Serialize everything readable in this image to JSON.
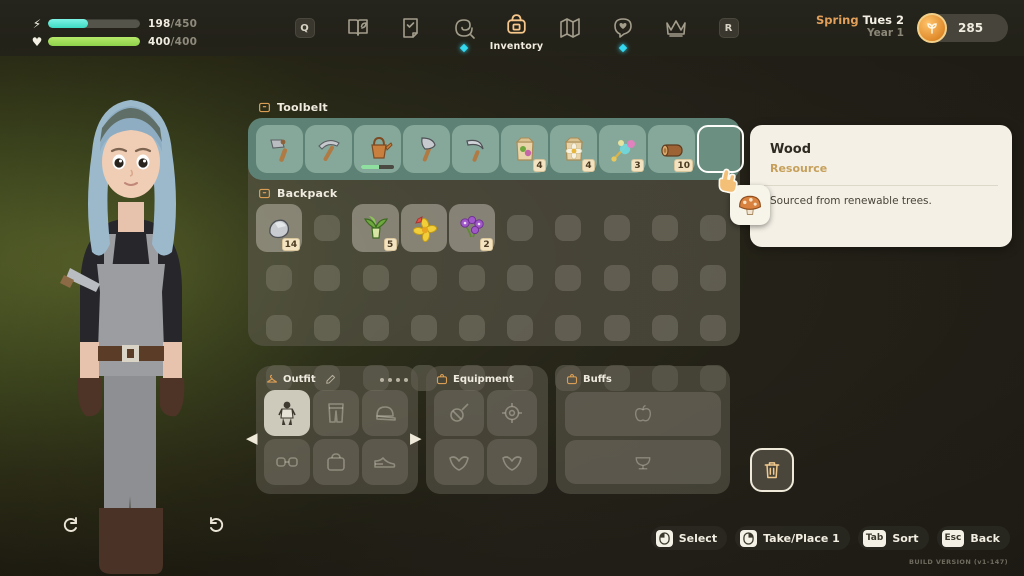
{
  "hud": {
    "energy": {
      "icon": "lightning-icon",
      "current": 198,
      "max": 450,
      "label": "198",
      "denom": "/450",
      "color": "#3ddbc3"
    },
    "health": {
      "icon": "heart-icon",
      "current": 400,
      "max": 400,
      "label": "400",
      "denom": "/400",
      "color": "#8ed14a"
    }
  },
  "nav": {
    "items": [
      {
        "name": "key-q",
        "icon": "key-q-icon",
        "label": "Q",
        "active": false,
        "dot": false
      },
      {
        "name": "journal",
        "icon": "book-leaf-icon",
        "label": "",
        "active": false,
        "dot": false
      },
      {
        "name": "quests",
        "icon": "scroll-check-icon",
        "label": "",
        "active": false,
        "dot": false
      },
      {
        "name": "skills",
        "icon": "skill-swirl-icon",
        "label": "",
        "active": false,
        "dot": true
      },
      {
        "name": "inventory",
        "icon": "backpack-icon",
        "label": "Inventory",
        "active": true,
        "dot": false
      },
      {
        "name": "map",
        "icon": "map-icon",
        "label": "",
        "active": false,
        "dot": false
      },
      {
        "name": "social",
        "icon": "heart-chat-icon",
        "label": "",
        "active": false,
        "dot": true
      },
      {
        "name": "crown",
        "icon": "crown-icon",
        "label": "",
        "active": false,
        "dot": false
      },
      {
        "name": "key-r",
        "icon": "key-r-icon",
        "label": "R",
        "active": false,
        "dot": false
      }
    ]
  },
  "date": {
    "season": "Spring",
    "day": "Tues 2",
    "year": "Year 1"
  },
  "currency": {
    "icon": "coin-icon",
    "amount": "285"
  },
  "character": {
    "rotate_left": "rotate-left-icon",
    "rotate_right": "rotate-right-icon"
  },
  "toolbelt": {
    "title": "Toolbelt",
    "icon": "toolbelt-icon",
    "slots": [
      {
        "name": "hoe",
        "icon": "🪓",
        "count": "",
        "durability": 0,
        "empty": false,
        "highlighted": false
      },
      {
        "name": "pickaxe",
        "icon": "⛏",
        "count": "",
        "durability": 0,
        "empty": false,
        "highlighted": false
      },
      {
        "name": "watering-can",
        "icon": "🫗",
        "count": "",
        "durability": 55,
        "empty": false,
        "highlighted": false
      },
      {
        "name": "axe",
        "icon": "🪓",
        "count": "",
        "durability": 0,
        "empty": false,
        "highlighted": false
      },
      {
        "name": "scythe",
        "icon": "🌾",
        "count": "",
        "durability": 0,
        "empty": false,
        "highlighted": false
      },
      {
        "name": "turnip-seeds",
        "icon": "🌱",
        "count": "4",
        "durability": 0,
        "empty": false,
        "highlighted": false
      },
      {
        "name": "flower-seeds",
        "icon": "🌼",
        "count": "4",
        "durability": 0,
        "empty": false,
        "highlighted": false
      },
      {
        "name": "bubble-wand",
        "icon": "🪄",
        "count": "3",
        "durability": 0,
        "empty": false,
        "highlighted": false
      },
      {
        "name": "wood",
        "icon": "🪵",
        "count": "10",
        "durability": 0,
        "empty": false,
        "highlighted": false
      },
      {
        "name": "empty-slot",
        "icon": "",
        "count": "",
        "durability": 0,
        "empty": true,
        "highlighted": true
      }
    ]
  },
  "backpack": {
    "title": "Backpack",
    "icon": "backpack-small-icon",
    "columns": 10,
    "rows": 4,
    "slots": [
      {
        "name": "stone",
        "icon": "🪨",
        "count": "14"
      },
      {
        "name": "empty",
        "icon": "",
        "count": ""
      },
      {
        "name": "leek",
        "icon": "🌿",
        "count": "5"
      },
      {
        "name": "daffodil",
        "icon": "🌼",
        "count": ""
      },
      {
        "name": "purple-flowers",
        "icon": "💐",
        "count": "2"
      }
    ]
  },
  "tooltip": {
    "name": "Wood",
    "type": "Resource",
    "description": "Sourced from renewable trees."
  },
  "drag": {
    "icon": "🍄",
    "name": "mushroom",
    "cursor": "pointer-hand-icon"
  },
  "outfit": {
    "title": "Outfit",
    "icon": "hanger-icon",
    "edit_icon": "pencil-icon",
    "page_dots": 4,
    "slots": [
      {
        "name": "body-outfit",
        "icon": "🧍",
        "selected": true
      },
      {
        "name": "pants",
        "icon": "👖",
        "selected": false
      },
      {
        "name": "hat",
        "icon": "🧢",
        "selected": false
      },
      {
        "name": "glasses",
        "icon": "👓",
        "selected": false
      },
      {
        "name": "bag",
        "icon": "👜",
        "selected": false
      },
      {
        "name": "shoes",
        "icon": "👟",
        "selected": false
      }
    ],
    "arrow_left": "arrow-left-icon",
    "arrow_right": "arrow-right-icon"
  },
  "equipment": {
    "title": "Equipment",
    "icon": "equipment-icon",
    "slots": [
      {
        "name": "amulet",
        "icon": "🔮"
      },
      {
        "name": "charm",
        "icon": "✳"
      },
      {
        "name": "ring-left",
        "icon": "💍"
      },
      {
        "name": "ring-right",
        "icon": "💍"
      }
    ]
  },
  "buffs": {
    "title": "Buffs",
    "icon": "buffs-icon",
    "slots": [
      {
        "name": "food-buff",
        "icon": "🍎"
      },
      {
        "name": "drink-buff",
        "icon": "🍸"
      }
    ]
  },
  "trash": {
    "name": "trash-button",
    "icon": "🗑"
  },
  "hints": [
    {
      "key": "LMB",
      "key_icon": "mouse-left-icon",
      "label": "Select"
    },
    {
      "key": "RMB",
      "key_icon": "mouse-right-icon",
      "label": "Take/Place 1"
    },
    {
      "key": "Tab",
      "key_icon": "",
      "label": "Sort"
    },
    {
      "key": "Esc",
      "key_icon": "",
      "label": "Back"
    }
  ],
  "build_version": "BUILD VERSION (v1-147)"
}
